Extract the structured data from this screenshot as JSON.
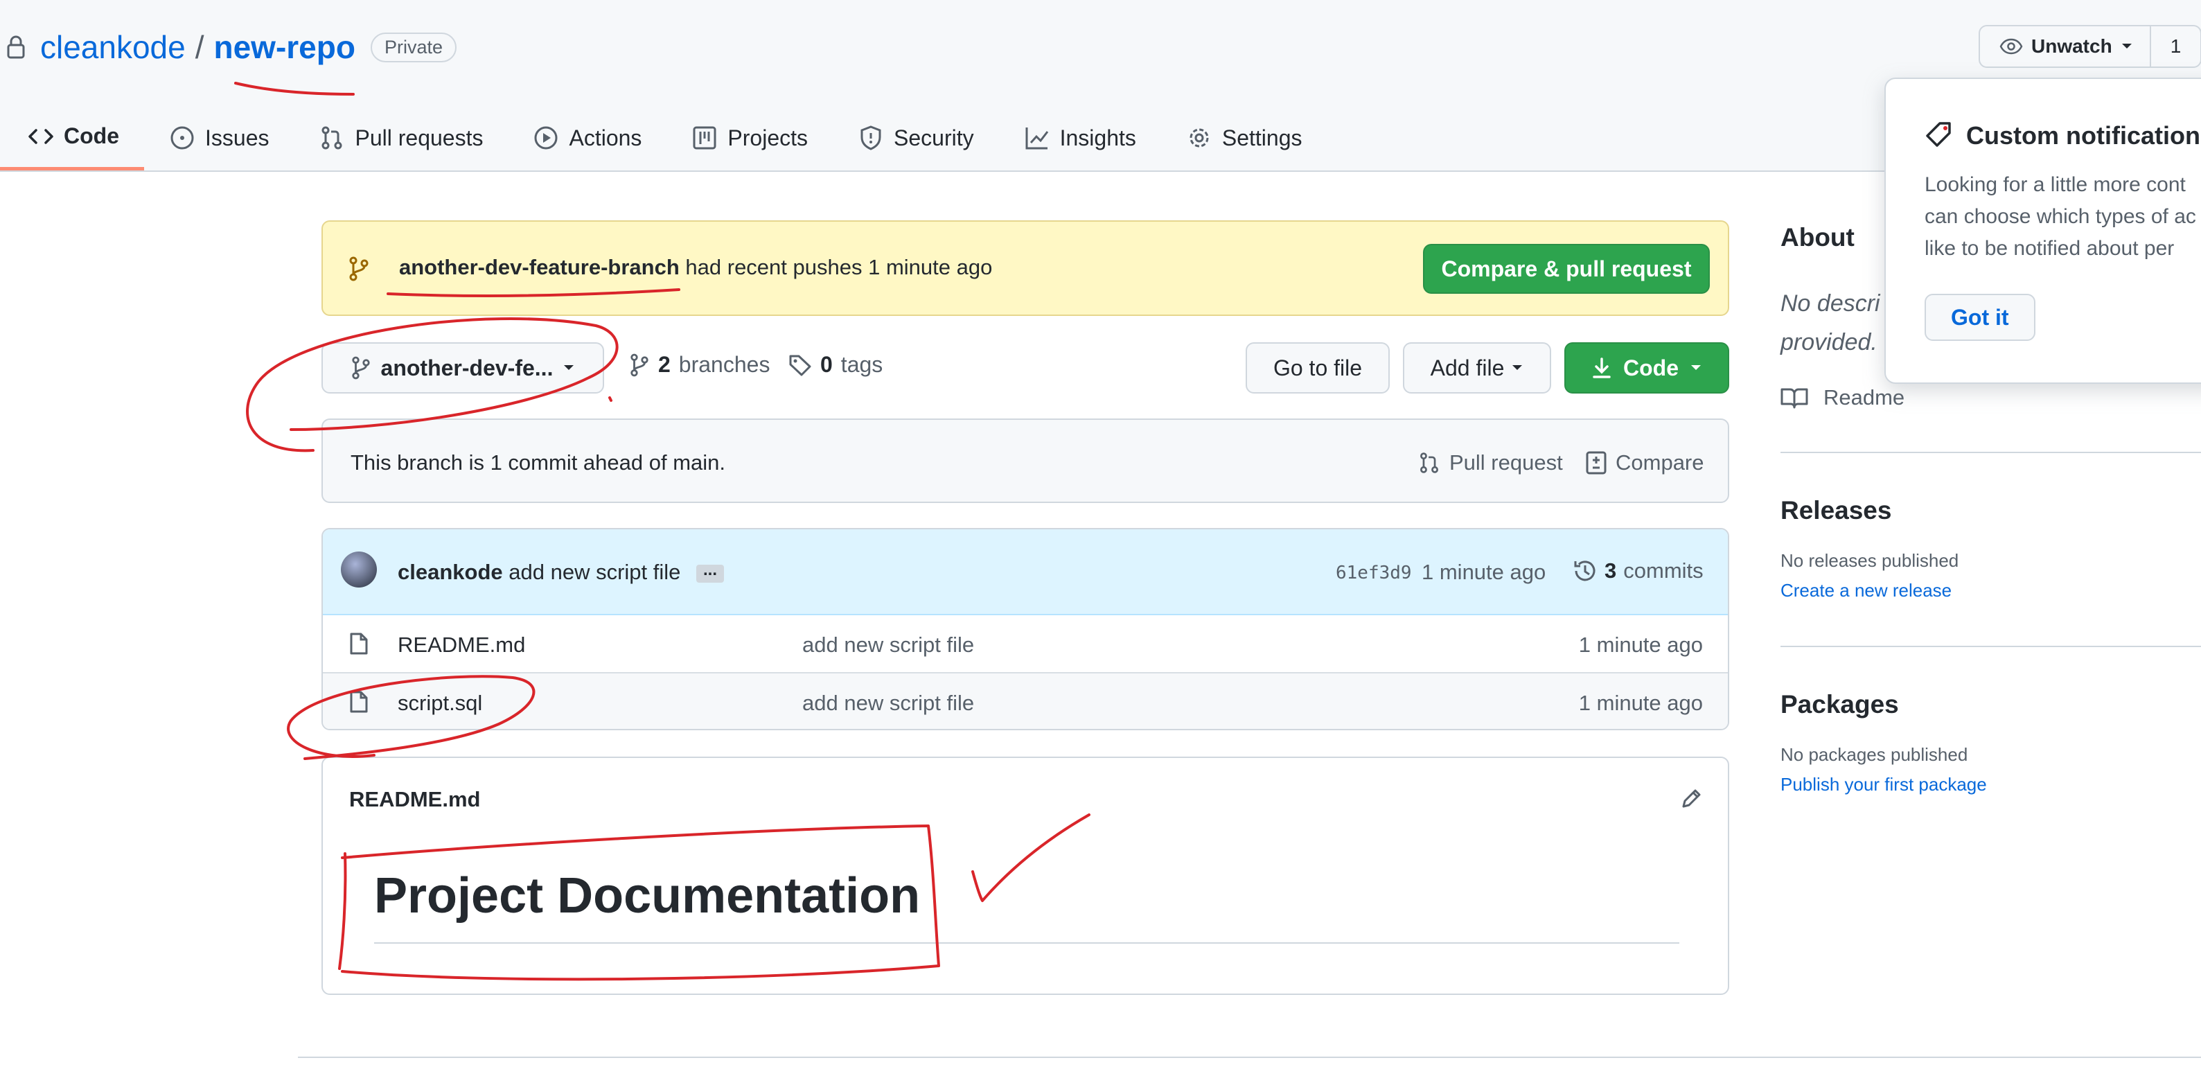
{
  "repo": {
    "owner": "cleankode",
    "separator": "/",
    "name": "new-repo",
    "visibility": "Private"
  },
  "watch": {
    "label": "Unwatch",
    "count": "1"
  },
  "tabs": [
    {
      "label": "Code",
      "icon": "code-icon",
      "active": true
    },
    {
      "label": "Issues",
      "icon": "issue-icon"
    },
    {
      "label": "Pull requests",
      "icon": "pull-request-icon"
    },
    {
      "label": "Actions",
      "icon": "play-icon"
    },
    {
      "label": "Projects",
      "icon": "project-board-icon"
    },
    {
      "label": "Security",
      "icon": "shield-icon"
    },
    {
      "label": "Insights",
      "icon": "graph-icon"
    },
    {
      "label": "Settings",
      "icon": "gear-icon"
    }
  ],
  "popover": {
    "title": "Custom notification s",
    "lines": [
      "Looking for a little more cont",
      "can choose which types of ac",
      "like to be notified about per"
    ],
    "button": "Got it"
  },
  "banner": {
    "branch": "another-dev-feature-branch",
    "message": " had recent pushes 1 minute ago",
    "button": "Compare & pull request"
  },
  "branch_bar": {
    "current_branch": "another-dev-fe...",
    "branches_count": "2",
    "branches_label": "branches",
    "tags_count": "0",
    "tags_label": "tags",
    "goto_file": "Go to file",
    "add_file": "Add file",
    "code": "Code"
  },
  "ahead": {
    "text": "This branch is 1 commit ahead of main.",
    "pull_request": "Pull request",
    "compare": "Compare"
  },
  "latest_commit": {
    "author": "cleankode",
    "message": "add new script file",
    "ellipsis": "...",
    "sha": "61ef3d9",
    "time": "1 minute ago",
    "commits_count": "3",
    "commits_label": "commits"
  },
  "files": [
    {
      "name": "README.md",
      "message": "add new script file",
      "time": "1 minute ago"
    },
    {
      "name": "script.sql",
      "message": "add new script file",
      "time": "1 minute ago"
    }
  ],
  "readme": {
    "filename": "README.md",
    "heading": "Project Documentation"
  },
  "sidebar": {
    "about": {
      "title": "About",
      "description_lines": [
        "No descri",
        "provided."
      ],
      "readme_link": "Readme"
    },
    "releases": {
      "title": "Releases",
      "empty": "No releases published",
      "link": "Create a new release"
    },
    "packages": {
      "title": "Packages",
      "empty": "No packages published",
      "link": "Publish your first package"
    }
  },
  "colors": {
    "link": "#0969da",
    "green_button": "#2da44e",
    "annotation": "#d9252a",
    "banner_bg": "#fff8c5",
    "commit_header_bg": "#ddf4ff"
  }
}
